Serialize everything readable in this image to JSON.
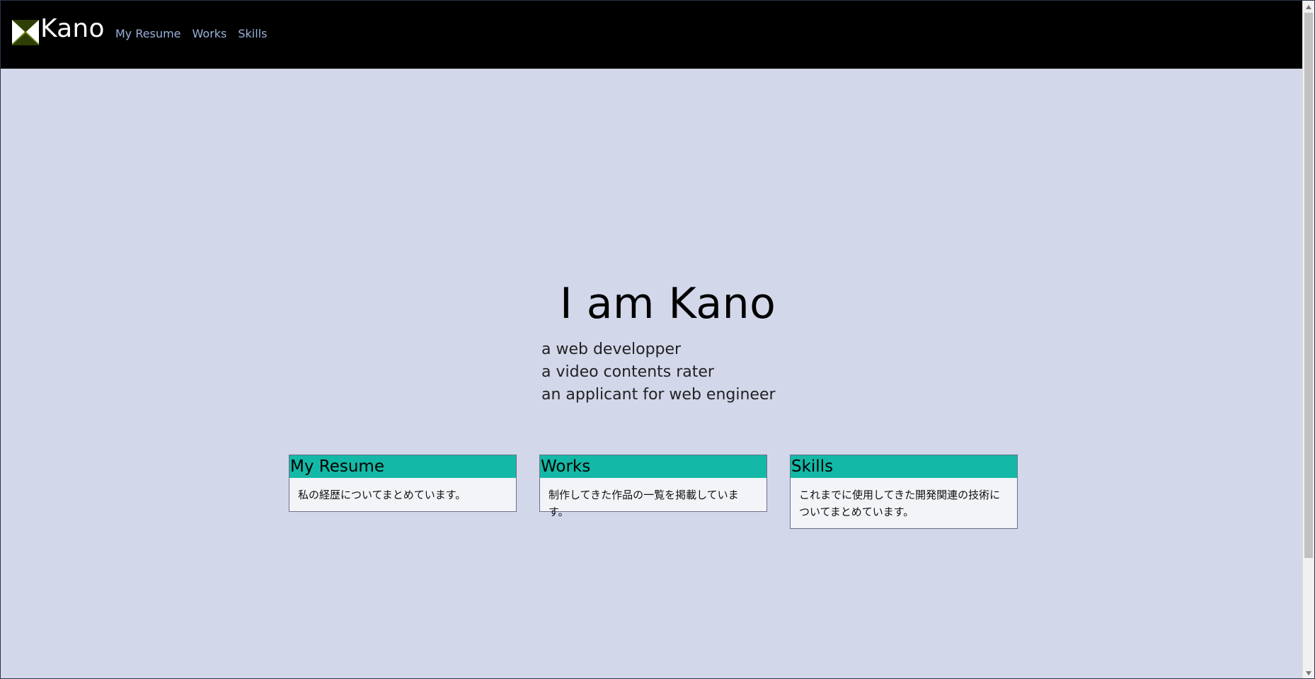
{
  "header": {
    "brand": "Kano",
    "nav": [
      {
        "label": "My Resume"
      },
      {
        "label": "Works"
      },
      {
        "label": "Skills"
      }
    ]
  },
  "hero": {
    "title": "I am Kano",
    "lines": [
      "a web developper",
      "a video contents rater",
      "an applicant for web engineer"
    ]
  },
  "cards": [
    {
      "title": "My Resume",
      "body": "私の経歴についてまとめています。"
    },
    {
      "title": "Works",
      "body": "制作してきた作品の一覧を掲載しています。"
    },
    {
      "title": "Skills",
      "body": "これまでに使用してきた開発関連の技術についてまとめています。"
    }
  ],
  "colors": {
    "background": "#d3d7ea",
    "header": "#000000",
    "card_header": "#14b8a6",
    "card_body": "#f2f4f8",
    "nav_text": "#9ab2d9",
    "logo": "#5f7e13"
  },
  "icons": {
    "logo": "kano-logo-icon",
    "scroll_up": "scroll-up-icon",
    "scroll_down": "scroll-down-icon"
  }
}
